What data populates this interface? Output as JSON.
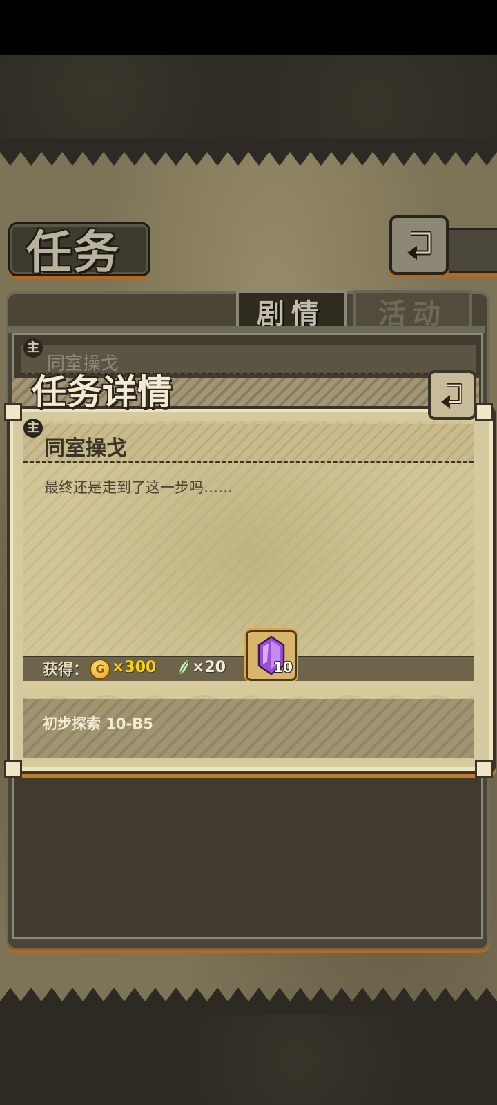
{
  "screen": {
    "title": "任务",
    "tabs": [
      {
        "label": "剧情",
        "active": true
      },
      {
        "label": "活动",
        "active": false
      }
    ],
    "background_quest": {
      "name": "同室操戈"
    }
  },
  "modal": {
    "heading": "任务详情",
    "quest_name": "同室操戈",
    "description": "最终还是走到了这一步吗……",
    "reward_label": "获得：",
    "rewards": {
      "coin_symbol": "G",
      "coin_amount": "×300",
      "feather_amount": "×20",
      "gem_count": "10"
    },
    "requirement": "初步探索 10-B5"
  },
  "icons": {
    "back": "back-arrow-icon",
    "key": "key-icon",
    "coin": "gold-coin-icon",
    "feather": "feather-icon",
    "gem": "purple-gem-icon"
  },
  "colors": {
    "accent_orange": "#c07a2a",
    "coin_text": "#ffd400",
    "gem": "#9b4fd1"
  }
}
